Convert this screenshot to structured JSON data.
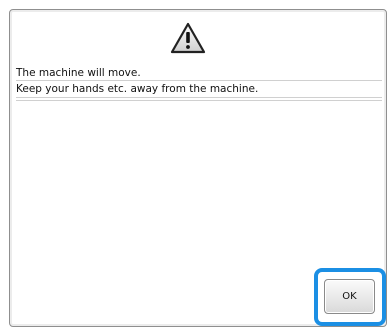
{
  "dialog": {
    "icon": "warning-icon",
    "message_line_1": "The machine will move.",
    "message_line_2": "Keep your hands etc. away from the machine.",
    "ok_label": "OK"
  },
  "colors": {
    "highlight": "#1b8fe4",
    "text": "#111111"
  }
}
